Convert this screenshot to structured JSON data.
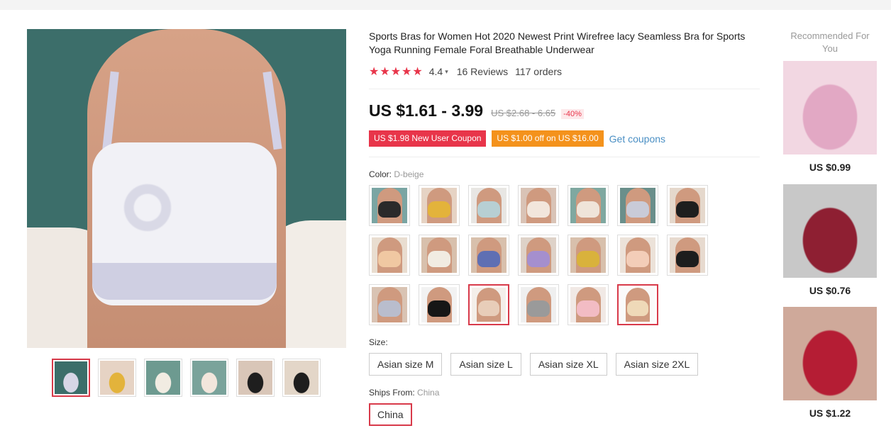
{
  "product": {
    "title": "Sports Bras for Women Hot 2020 Newest Print Wirefree lacy Seamless Bra for Sports Yoga Running Female Foral Breathable Underwear",
    "stars": "★★★★★",
    "rating": "4.4",
    "reviews": "16 Reviews",
    "orders": "117 orders"
  },
  "price": {
    "current": "US $1.61 - 3.99",
    "original": "US $2.68 - 6.65",
    "discount": "-40%"
  },
  "coupons": {
    "new_user": "US $1.98 New User Coupon",
    "store": "US $1.00 off on US $16.00",
    "get_link": "Get coupons"
  },
  "color": {
    "label": "Color:",
    "selected": "D-beige",
    "swatches": [
      {
        "tone": "#2a2a2a",
        "bg": "#7aa5a3"
      },
      {
        "tone": "#e3b33b",
        "bg": "#e6d3c4"
      },
      {
        "tone": "#b7cfd3",
        "bg": "#e8e6e3"
      },
      {
        "tone": "#f2e6dc",
        "bg": "#d9c3b6"
      },
      {
        "tone": "#efe4d9",
        "bg": "#7fa8a0"
      },
      {
        "tone": "#c9cbd8",
        "bg": "#6a8f8b"
      },
      {
        "tone": "#1e1e1e",
        "bg": "#e5d8cc"
      },
      {
        "tone": "#f0c8a2",
        "bg": "#e9ddd0"
      },
      {
        "tone": "#f1ece2",
        "bg": "#d8c0ac"
      },
      {
        "tone": "#5f6fb3",
        "bg": "#d8c0ac"
      },
      {
        "tone": "#a58fce",
        "bg": "#ded2c8"
      },
      {
        "tone": "#d9b23c",
        "bg": "#d8c0ac"
      },
      {
        "tone": "#f3cdb8",
        "bg": "#ece2d9"
      },
      {
        "tone": "#1d1d1d",
        "bg": "#e7dacf"
      },
      {
        "tone": "#b9bdcd",
        "bg": "#d9c3b3"
      },
      {
        "tone": "#161616",
        "bg": "#f2f2f2"
      },
      {
        "tone": "#e8cdb9",
        "bg": "#f4efea"
      },
      {
        "tone": "#9a9a9a",
        "bg": "#efefef"
      },
      {
        "tone": "#f2bcc4",
        "bg": "#f1e9e5"
      },
      {
        "tone": "#efd9b8",
        "bg": "#fafafa"
      }
    ]
  },
  "size": {
    "label": "Size:",
    "options": [
      "Asian size M",
      "Asian size L",
      "Asian size XL",
      "Asian size 2XL"
    ]
  },
  "ships": {
    "label": "Ships From:",
    "value": "China",
    "option": "China"
  },
  "gallery_thumbs": [
    {
      "tone": "#d7d6e6",
      "bg": "#3c6e6a"
    },
    {
      "tone": "#e3b33b",
      "bg": "#e6d3c4"
    },
    {
      "tone": "#f1ece2",
      "bg": "#6d9a90"
    },
    {
      "tone": "#f2e6dc",
      "bg": "#7aa39b"
    },
    {
      "tone": "#1e1e1e",
      "bg": "#d9c6b8"
    },
    {
      "tone": "#1e1e1e",
      "bg": "#e3d6c8"
    }
  ],
  "recommended": {
    "title": "Recommended For You",
    "items": [
      {
        "price": "US $0.99",
        "tone": "#e2a8c4",
        "bg": "#f2d7e2"
      },
      {
        "price": "US $0.76",
        "tone": "#8e1f32",
        "bg": "#c8c8c8"
      },
      {
        "price": "US $1.22",
        "tone": "#b51d34",
        "bg": "#cfa99a"
      }
    ]
  }
}
